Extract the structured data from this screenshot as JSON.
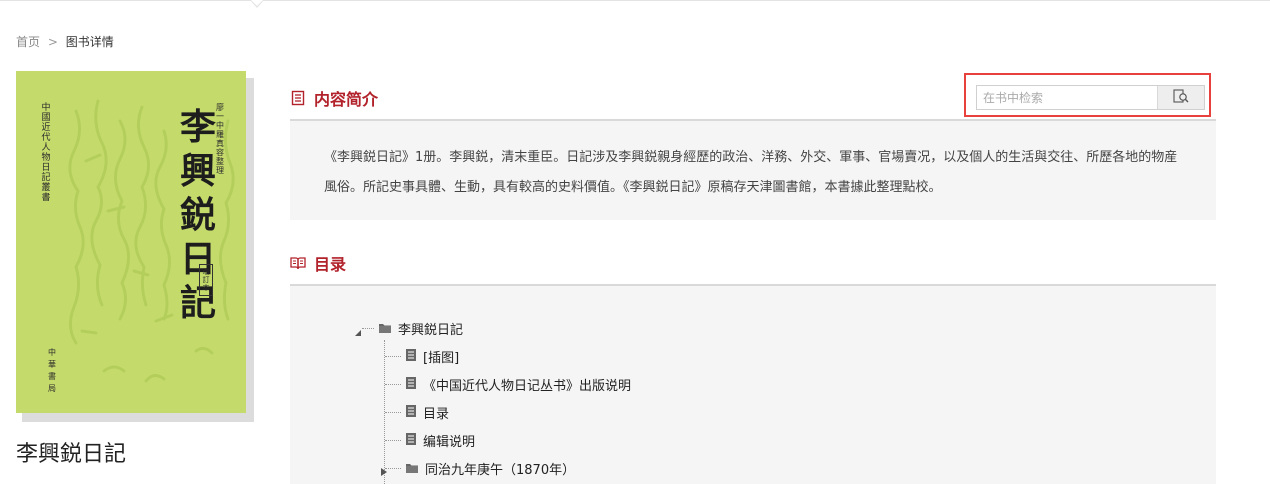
{
  "breadcrumb": {
    "home": "首页",
    "separator": ">",
    "current": "图书详情"
  },
  "book": {
    "title": "李興鋭日記",
    "cover": {
      "title": "李興鋭日記",
      "series": "中國近代人物日記叢書",
      "editor": "廖一中 羅真容 整理",
      "edition": "增訂本",
      "publisher": "中華書局",
      "background_color": "#c4db6c"
    }
  },
  "intro": {
    "heading": "内容简介",
    "icon": "document-icon",
    "text": "《李興鋭日記》1册。李興鋭，清末重臣。日記涉及李興鋭親身經歷的政治、洋務、外交、軍事、官場賣况，以及個人的生活與交往、所歷各地的物産風俗。所記史事具體、生動，具有較高的史料價值。《李興鋭日記》原稿存天津圖書館，本書據此整理點校。"
  },
  "search": {
    "placeholder": "在书中检索",
    "value": "",
    "button_icon": "search-in-document-icon"
  },
  "toc": {
    "heading": "目录",
    "icon": "open-book-icon",
    "root": {
      "label": "李興鋭日記",
      "expanded": true,
      "icon": "folder-icon"
    },
    "items": [
      {
        "label": "[插图]",
        "icon": "page-icon"
      },
      {
        "label": "《中国近代人物日记丛书》出版说明",
        "icon": "page-icon"
      },
      {
        "label": "目录",
        "icon": "page-icon"
      },
      {
        "label": "编辑说明",
        "icon": "page-icon"
      },
      {
        "label": "同治九年庚午（1870年）",
        "icon": "folder-icon",
        "expanded": false
      }
    ]
  },
  "colors": {
    "accent": "#b2222b",
    "highlight_border": "#e8403d",
    "panel_bg": "#f5f5f5"
  }
}
